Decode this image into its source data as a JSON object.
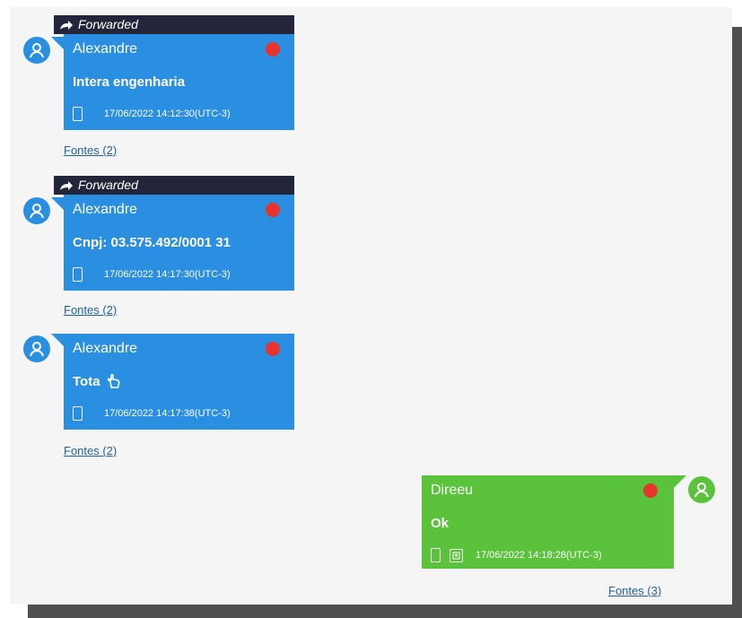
{
  "colors": {
    "incoming_bubble": "#2a8ee1",
    "outgoing_bubble": "#5bc33b",
    "forwarded_bar": "#23263a",
    "status_dot": "#e8332e",
    "link": "#1f5f9e",
    "background": "#f5f5f5"
  },
  "messages": [
    {
      "direction": "incoming",
      "forwarded_label": "Forwarded",
      "sender": "Alexandre",
      "text": "Intera engenharia",
      "timestamp": "17/06/2022 14:12:30(UTC-3)",
      "sources_link": "Fontes (2)",
      "icons": [
        "user-avatar-icon",
        "forward-arrow-icon",
        "red-status-dot",
        "phone-device-icon"
      ]
    },
    {
      "direction": "incoming",
      "forwarded_label": "Forwarded",
      "sender": "Alexandre",
      "text": "Cnpj: 03.575.492/0001 31",
      "timestamp": "17/06/2022 14:17:30(UTC-3)",
      "sources_link": "Fontes (2)",
      "icons": [
        "user-avatar-icon",
        "forward-arrow-icon",
        "red-status-dot",
        "phone-device-icon"
      ]
    },
    {
      "direction": "incoming",
      "sender": "Alexandre",
      "text": "Tota",
      "text_icon": "pointing-hand-icon",
      "timestamp": "17/06/2022 14:17:38(UTC-3)",
      "sources_link": "Fontes (2)",
      "icons": [
        "user-avatar-icon",
        "red-status-dot",
        "phone-device-icon"
      ]
    },
    {
      "direction": "outgoing",
      "sender": "Direeu",
      "text": "Ok",
      "timestamp": "17/06/2022 14:18:28(UTC-3)",
      "sources_link": "Fontes (3)",
      "icons": [
        "user-avatar-icon",
        "red-status-dot",
        "phone-device-icon",
        "image-icon"
      ]
    }
  ]
}
